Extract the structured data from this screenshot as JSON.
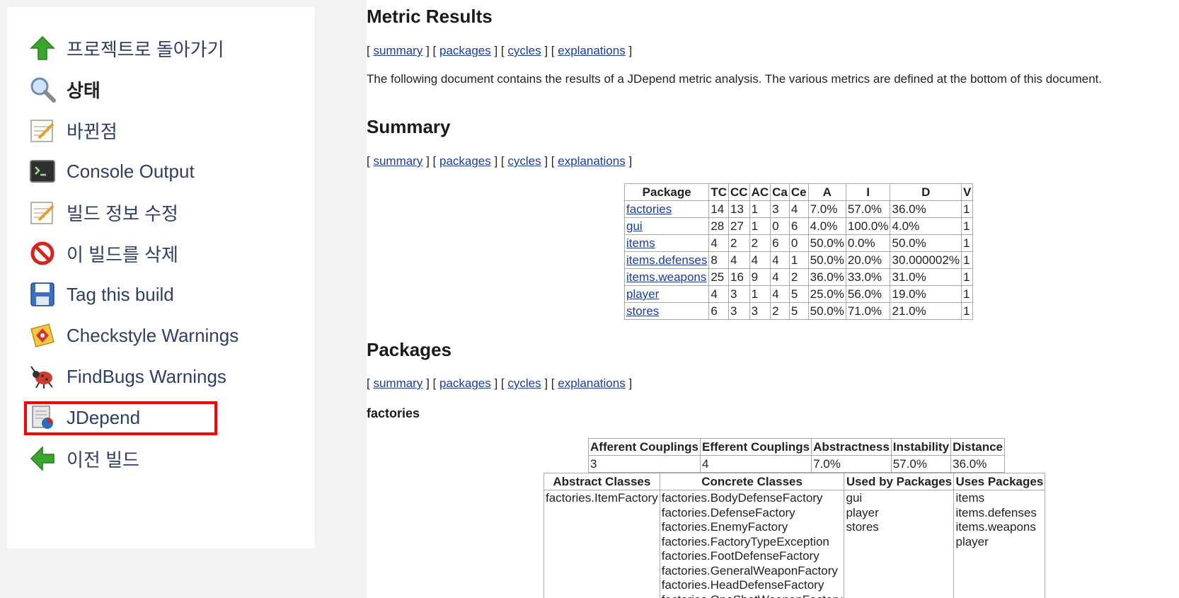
{
  "sidebar": {
    "items": [
      {
        "label": "프로젝트로 돌아가기",
        "icon": "up-arrow-icon"
      },
      {
        "label": "상태",
        "icon": "search-icon"
      },
      {
        "label": "바뀐점",
        "icon": "notepad-icon"
      },
      {
        "label": "Console Output",
        "icon": "terminal-icon"
      },
      {
        "label": "빌드 정보 수정",
        "icon": "notepad-icon"
      },
      {
        "label": "이 빌드를 삭제",
        "icon": "no-entry-icon"
      },
      {
        "label": "Tag this build",
        "icon": "floppy-disk-icon"
      },
      {
        "label": "Checkstyle Warnings",
        "icon": "checkstyle-icon"
      },
      {
        "label": "FindBugs Warnings",
        "icon": "bug-icon"
      },
      {
        "label": "JDepend",
        "icon": "jdepend-chart-icon"
      },
      {
        "label": "이전 빌드",
        "icon": "left-arrow-icon"
      }
    ]
  },
  "nav_links": {
    "summary": "summary",
    "packages": "packages",
    "cycles": "cycles",
    "explanations": "explanations"
  },
  "metric_results": {
    "title": "Metric Results",
    "description": "The following document contains the results of a JDepend metric analysis. The various metrics are defined at the bottom of this document."
  },
  "summary": {
    "title": "Summary",
    "headers": [
      "Package",
      "TC",
      "CC",
      "AC",
      "Ca",
      "Ce",
      "A",
      "I",
      "D",
      "V"
    ],
    "rows": [
      [
        "factories",
        "14",
        "13",
        "1",
        "3",
        "4",
        "7.0%",
        "57.0%",
        "36.0%",
        "1"
      ],
      [
        "gui",
        "28",
        "27",
        "1",
        "0",
        "6",
        "4.0%",
        "100.0%",
        "4.0%",
        "1"
      ],
      [
        "items",
        "4",
        "2",
        "2",
        "6",
        "0",
        "50.0%",
        "0.0%",
        "50.0%",
        "1"
      ],
      [
        "items.defenses",
        "8",
        "4",
        "4",
        "4",
        "1",
        "50.0%",
        "20.0%",
        "30.000002%",
        "1"
      ],
      [
        "items.weapons",
        "25",
        "16",
        "9",
        "4",
        "2",
        "36.0%",
        "33.0%",
        "31.0%",
        "1"
      ],
      [
        "player",
        "4",
        "3",
        "1",
        "4",
        "5",
        "25.0%",
        "56.0%",
        "19.0%",
        "1"
      ],
      [
        "stores",
        "6",
        "3",
        "3",
        "2",
        "5",
        "50.0%",
        "71.0%",
        "21.0%",
        "1"
      ]
    ]
  },
  "packages": {
    "title": "Packages",
    "package_name": "factories",
    "metrics_headers": [
      "Afferent Couplings",
      "Efferent Couplings",
      "Abstractness",
      "Instability",
      "Distance"
    ],
    "metrics_values": [
      "3",
      "4",
      "7.0%",
      "57.0%",
      "36.0%"
    ],
    "class_headers": [
      "Abstract Classes",
      "Concrete Classes",
      "Used by Packages",
      "Uses Packages"
    ],
    "abstract_classes": [
      "factories.ItemFactory"
    ],
    "concrete_classes": [
      "factories.BodyDefenseFactory",
      "factories.DefenseFactory",
      "factories.EnemyFactory",
      "factories.FactoryTypeException",
      "factories.FootDefenseFactory",
      "factories.GeneralWeaponFactory",
      "factories.HeadDefenseFactory",
      "factories.OneShotWeaponFactory"
    ],
    "used_by_packages": [
      "gui",
      "player",
      "stores"
    ],
    "uses_packages": [
      "items",
      "items.defenses",
      "items.weapons",
      "player"
    ]
  }
}
